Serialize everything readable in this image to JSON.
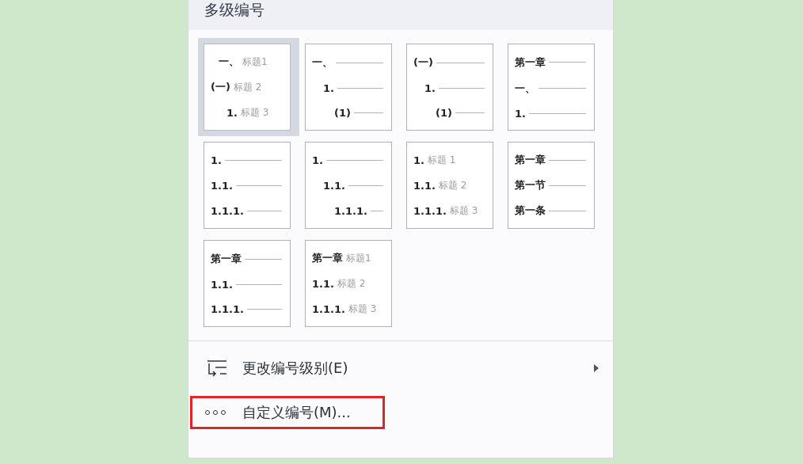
{
  "panel": {
    "title": "多级编号"
  },
  "presets": [
    {
      "selected": true,
      "kind": "stepped",
      "lines": [
        {
          "number": "一、",
          "heading": "标题1"
        },
        {
          "number": "(一)",
          "heading": "标题 2"
        },
        {
          "number": "1.",
          "heading": "标题 3"
        }
      ]
    },
    {
      "selected": false,
      "kind": "stepped",
      "lines": [
        {
          "number": "一、"
        },
        {
          "number": "1."
        },
        {
          "number": "(1)"
        }
      ]
    },
    {
      "selected": false,
      "kind": "stepped",
      "lines": [
        {
          "number": "(一)"
        },
        {
          "number": "1."
        },
        {
          "number": "(1)"
        }
      ]
    },
    {
      "selected": false,
      "kind": "flush",
      "lines": [
        {
          "number": "第一章"
        },
        {
          "number": "一、"
        },
        {
          "number": "1."
        }
      ]
    },
    {
      "selected": false,
      "kind": "flush",
      "lines": [
        {
          "number": "1."
        },
        {
          "number": "1.1."
        },
        {
          "number": "1.1.1."
        }
      ]
    },
    {
      "selected": false,
      "kind": "stepped",
      "lines": [
        {
          "number": "1."
        },
        {
          "number": "1.1."
        },
        {
          "number": "1.1.1."
        }
      ]
    },
    {
      "selected": false,
      "kind": "flush",
      "lines": [
        {
          "number": "1.",
          "heading": "标题 1"
        },
        {
          "number": "1.1.",
          "heading": "标题 2"
        },
        {
          "number": "1.1.1.",
          "heading": "标题 3"
        }
      ]
    },
    {
      "selected": false,
      "kind": "flush",
      "lines": [
        {
          "number": "第一章"
        },
        {
          "number": "第一节"
        },
        {
          "number": "第一条"
        }
      ]
    },
    {
      "selected": false,
      "kind": "flush",
      "lines": [
        {
          "number": "第一章"
        },
        {
          "number": "1.1."
        },
        {
          "number": "1.1.1."
        }
      ]
    },
    {
      "selected": false,
      "kind": "flush",
      "lines": [
        {
          "number": "第一章",
          "heading": "标题1"
        },
        {
          "number": "1.1.",
          "heading": "标题 2"
        },
        {
          "number": "1.1.1.",
          "heading": "标题 3"
        }
      ]
    }
  ],
  "menu_items": [
    {
      "kind": "level",
      "label": "更改编号级别(E)",
      "submenu": true,
      "highlighted": false
    },
    {
      "kind": "custom",
      "label": "自定义编号(M)...",
      "submenu": false,
      "highlighted": true
    }
  ]
}
